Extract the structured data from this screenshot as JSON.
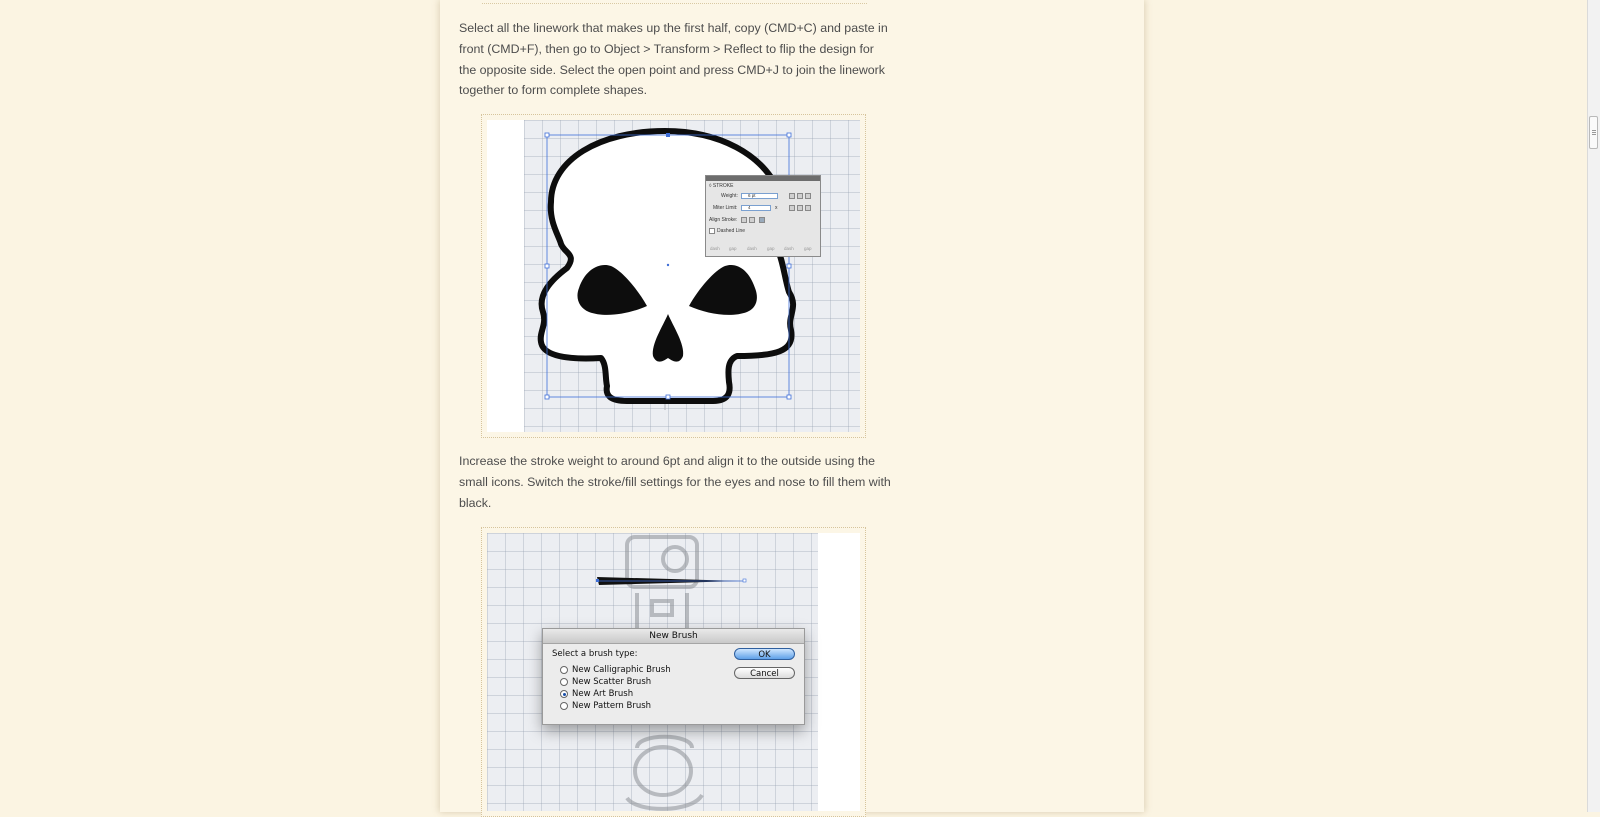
{
  "article": {
    "paragraph_reflect": "Select all the linework that makes up the first half, copy (CMD+C) and paste in front (CMD+F), then go to Object > Transform > Reflect to flip the design for the opposite side. Select the open point and press CMD+J to join the linework together to form complete shapes.",
    "paragraph_stroke": "Increase the stroke weight to around 6pt and align it to the outside using the small icons. Switch the stroke/fill settings for the eyes and nose to fill them with black."
  },
  "stroke_panel": {
    "tab": "◊ STROKE",
    "weight_label": "Weight:",
    "weight_value": "6 pt",
    "miter_label": "Miter Limit:",
    "miter_value": "4",
    "miter_unit": "x",
    "align_label": "Align Stroke:",
    "dashed_label": "Dashed Line",
    "dash_labels": [
      "dash",
      "gap",
      "dash",
      "gap",
      "dash",
      "gap"
    ]
  },
  "brush_dialog": {
    "title": "New Brush",
    "prompt": "Select a brush type:",
    "options": [
      "New Calligraphic Brush",
      "New Scatter Brush",
      "New Art Brush",
      "New Pattern Brush"
    ],
    "selected_index": 2,
    "ok_label": "OK",
    "cancel_label": "Cancel"
  }
}
